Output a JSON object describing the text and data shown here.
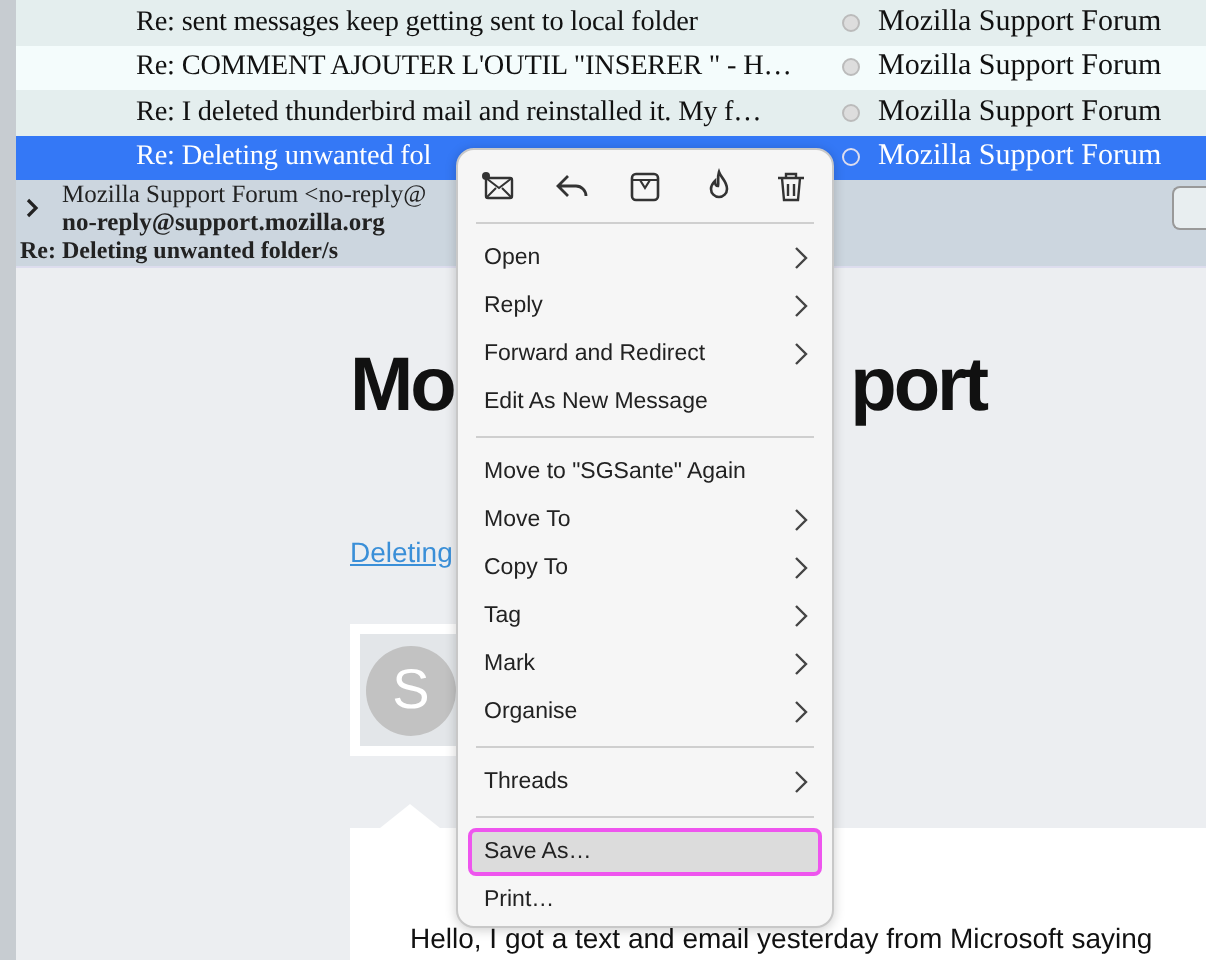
{
  "message_list": {
    "rows": [
      {
        "subject": "Re: sent messages keep getting sent to local folder",
        "correspondent": "Mozilla Support Forum",
        "selected": false
      },
      {
        "subject": "Re: COMMENT AJOUTER L'OUTIL \"INSERER \" - H…",
        "correspondent": "Mozilla Support Forum",
        "selected": false
      },
      {
        "subject": "Re: I deleted thunderbird mail and reinstalled it. My f…",
        "correspondent": "Mozilla Support Forum",
        "selected": false
      },
      {
        "subject": "Re: Deleting unwanted fol",
        "correspondent": "Mozilla Support Forum",
        "selected": true
      }
    ]
  },
  "message_header": {
    "from": "Mozilla Support Forum <no-reply@",
    "address": "no-reply@support.mozilla.org",
    "subject": "Re: Deleting unwanted folder/s"
  },
  "message_body": {
    "heading_parts": [
      "Mo",
      "port"
    ],
    "link": "Deleting",
    "avatar_letter": "S",
    "text": "Hello, I got a text and email yesterday from Microsoft saying"
  },
  "context_menu": {
    "items": [
      {
        "kind": "toolbar"
      },
      {
        "kind": "separator"
      },
      {
        "kind": "item",
        "label": "Open",
        "submenu": true,
        "selected": false
      },
      {
        "kind": "item",
        "label": "Reply",
        "submenu": true,
        "selected": false
      },
      {
        "kind": "item",
        "label": "Forward and Redirect",
        "submenu": true,
        "selected": false
      },
      {
        "kind": "item",
        "label": "Edit As New Message",
        "submenu": false,
        "selected": false
      },
      {
        "kind": "separator"
      },
      {
        "kind": "item",
        "label": "Move to \"SGSante\" Again",
        "submenu": false,
        "selected": false
      },
      {
        "kind": "item",
        "label": "Move To",
        "submenu": true,
        "selected": false
      },
      {
        "kind": "item",
        "label": "Copy To",
        "submenu": true,
        "selected": false
      },
      {
        "kind": "item",
        "label": "Tag",
        "submenu": true,
        "selected": false
      },
      {
        "kind": "item",
        "label": "Mark",
        "submenu": true,
        "selected": false
      },
      {
        "kind": "item",
        "label": "Organise",
        "submenu": true,
        "selected": false
      },
      {
        "kind": "separator"
      },
      {
        "kind": "item",
        "label": "Threads",
        "submenu": true,
        "selected": false
      },
      {
        "kind": "separator"
      },
      {
        "kind": "item",
        "label": "Save As…",
        "submenu": false,
        "selected": true
      },
      {
        "kind": "item",
        "label": "Print…",
        "submenu": false,
        "selected": false
      }
    ]
  }
}
